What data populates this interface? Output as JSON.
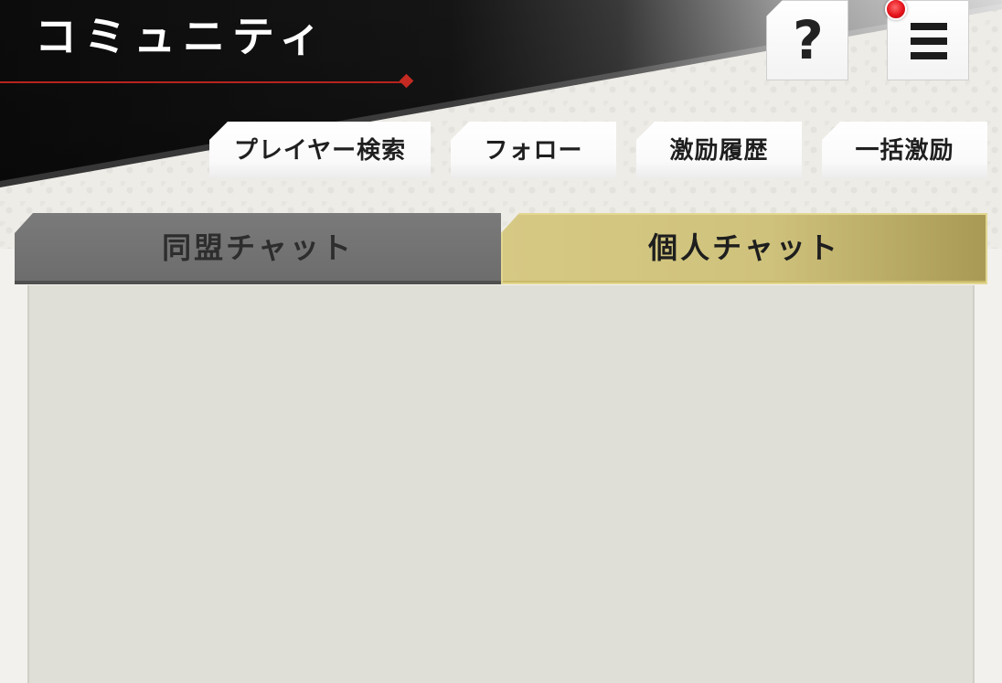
{
  "header": {
    "title": "コミュニティ",
    "help_icon": "question-mark-icon",
    "help_glyph": "?",
    "menu_icon": "hamburger-menu-icon",
    "notification_dot_color": "#e5131b",
    "accent_color": "#b8231f"
  },
  "actions": {
    "player_search": "プレイヤー検索",
    "follow": "フォロー",
    "cheer_history": "激励履歴",
    "bulk_cheer": "一括激励"
  },
  "tabs": [
    {
      "label": "同盟チャット",
      "active": false,
      "color": "#6f6f6f"
    },
    {
      "label": "個人チャット",
      "active": true,
      "color": "#d3c67f"
    }
  ]
}
